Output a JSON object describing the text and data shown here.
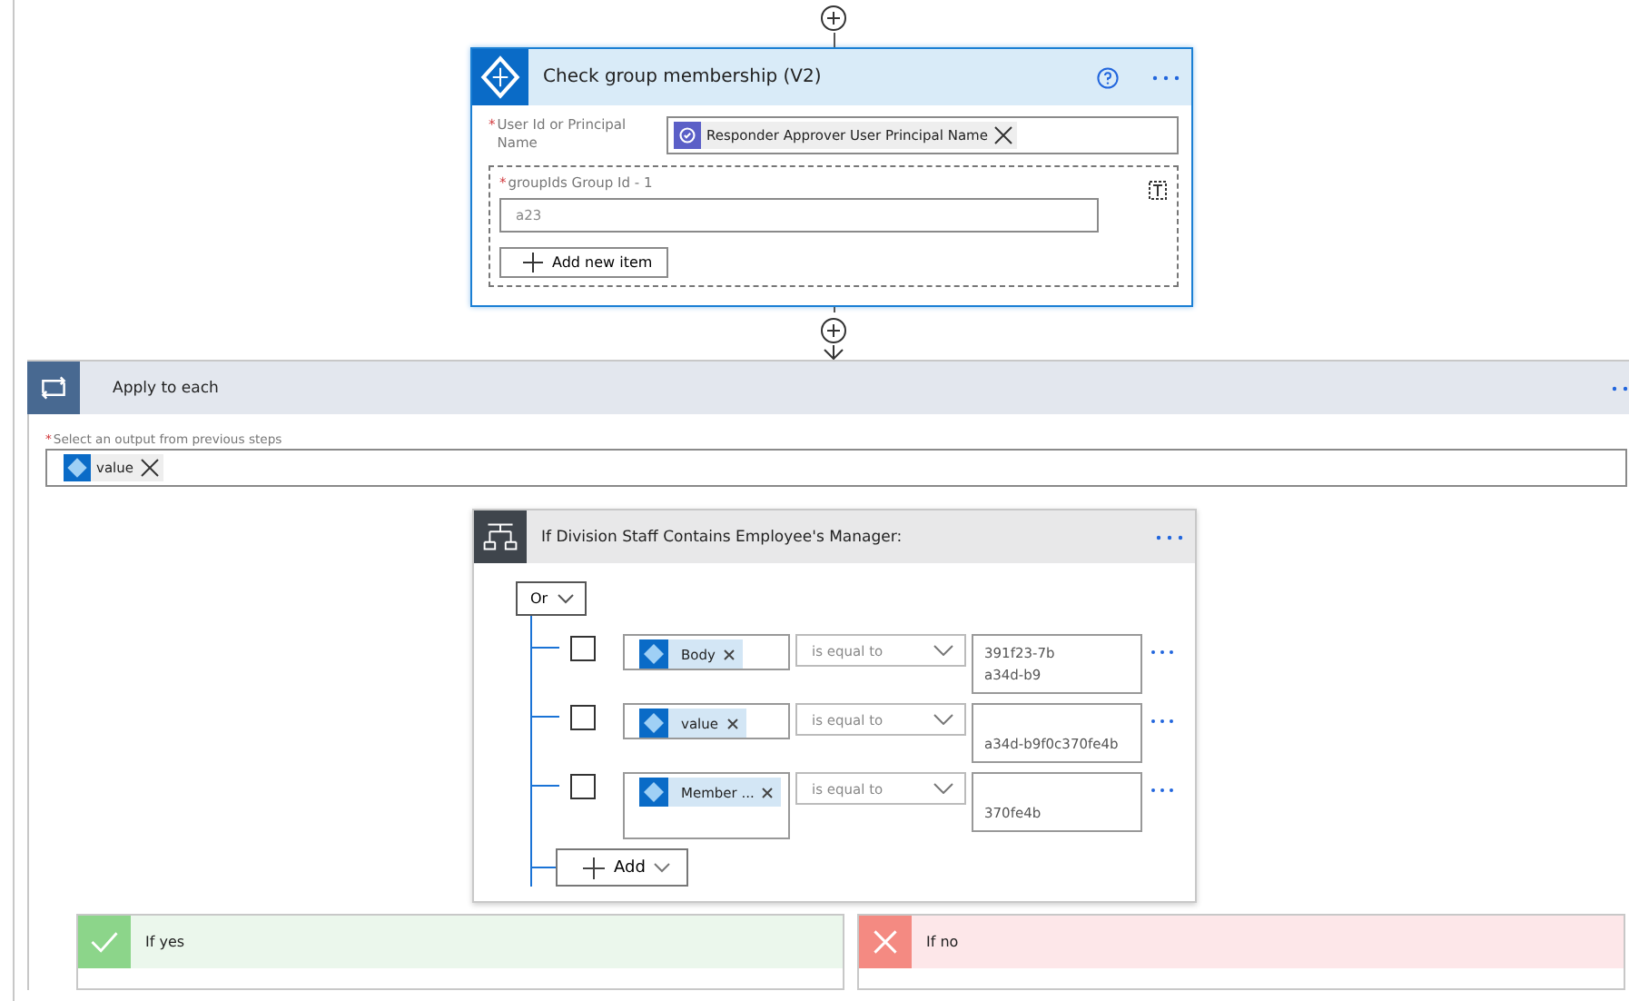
{
  "check_card": {
    "title": "Check group membership (V2)",
    "fields": [
      {
        "label": "User Id or Principal Name",
        "required_mark": "*",
        "token": "Responder Approver User Principal Name"
      }
    ],
    "array_field": {
      "label": "groupIds Group Id - 1",
      "required_mark": "*",
      "value": "a23",
      "add_label": "Add new item"
    }
  },
  "apply_each": {
    "title": "Apply to each",
    "field_label": "Select an output from previous steps",
    "required_mark": "*",
    "token": "value"
  },
  "condition": {
    "title": "If Division Staff Contains Employee's Manager:",
    "group_operator": "Or",
    "rows": [
      {
        "checked": false,
        "token": "Body",
        "operator": "is equal to",
        "value_lines": [
          "391f23-7b",
          "a34d-b9"
        ]
      },
      {
        "checked": false,
        "token": "value",
        "operator": "is equal to",
        "value_lines": [
          "a34d-b9f0c370fe4b"
        ]
      },
      {
        "checked": false,
        "token": "Member ...",
        "operator": "is equal to",
        "value_lines": [
          "370fe4b"
        ]
      }
    ],
    "add_label": "Add"
  },
  "branches": [
    {
      "kind": "yes",
      "label": "If yes"
    },
    {
      "kind": "no",
      "label": "If no"
    }
  ]
}
